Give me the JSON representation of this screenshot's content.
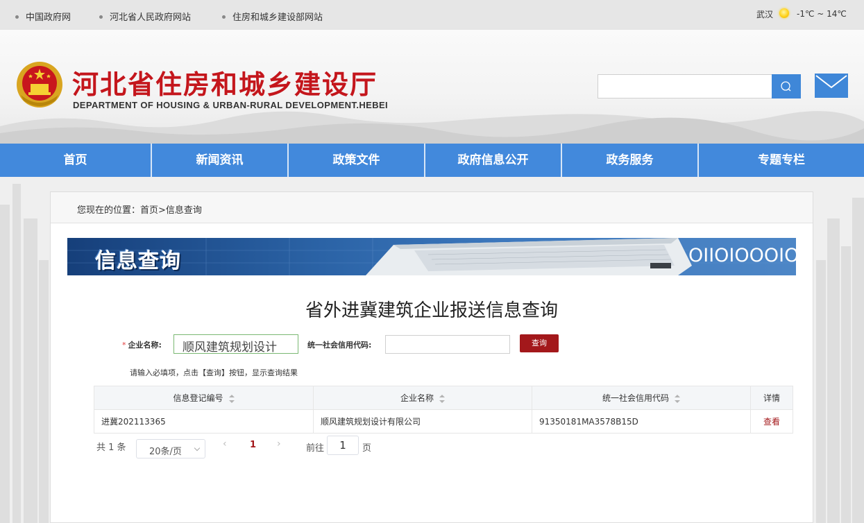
{
  "topbar": {
    "links": [
      "中国政府网",
      "河北省人民政府网站",
      "住房和城乡建设部网站"
    ],
    "city": "武汉",
    "weather_icon": "sun-icon",
    "temperature": "-1℃ ~ 14℃"
  },
  "header": {
    "title": "河北省住房和城乡建设厅",
    "subtitle": "DEPARTMENT OF HOUSING & URBAN-RURAL DEVELOPMENT.HEBEI",
    "search_placeholder": ""
  },
  "nav": {
    "items": [
      "首页",
      "新闻资讯",
      "政策文件",
      "政府信息公开",
      "政务服务",
      "专题专栏"
    ]
  },
  "breadcrumb": "您现在的位置：首页>信息查询",
  "banner": {
    "title": "信息查询",
    "binary": "OIIOIOOOIOIII"
  },
  "query": {
    "title": "省外进冀建筑企业报送信息查询",
    "name_label": "企业名称:",
    "name_required": "*",
    "name_value": "顺风建筑规划设计",
    "code_label": "统一社会信用代码:",
    "code_value": "",
    "button": "查询",
    "hint": "请输入必填项，点击【查询】按钮，显示查询结果"
  },
  "table": {
    "headers": [
      "信息登记编号",
      "企业名称",
      "统一社会信用代码",
      "详情"
    ],
    "rows": [
      [
        "进冀202113365",
        "顺风建筑规划设计有限公司",
        "91350181MA3578B15D",
        "查看"
      ]
    ]
  },
  "pagination": {
    "total": "共 1 条",
    "page_size": "20条/页",
    "current": "1",
    "goto_prefix": "前往",
    "goto_value": "1",
    "goto_suffix": "页"
  },
  "colors": {
    "nav_blue": "#4289dc",
    "title_red": "#c4161c",
    "button_red": "#a3181b"
  }
}
